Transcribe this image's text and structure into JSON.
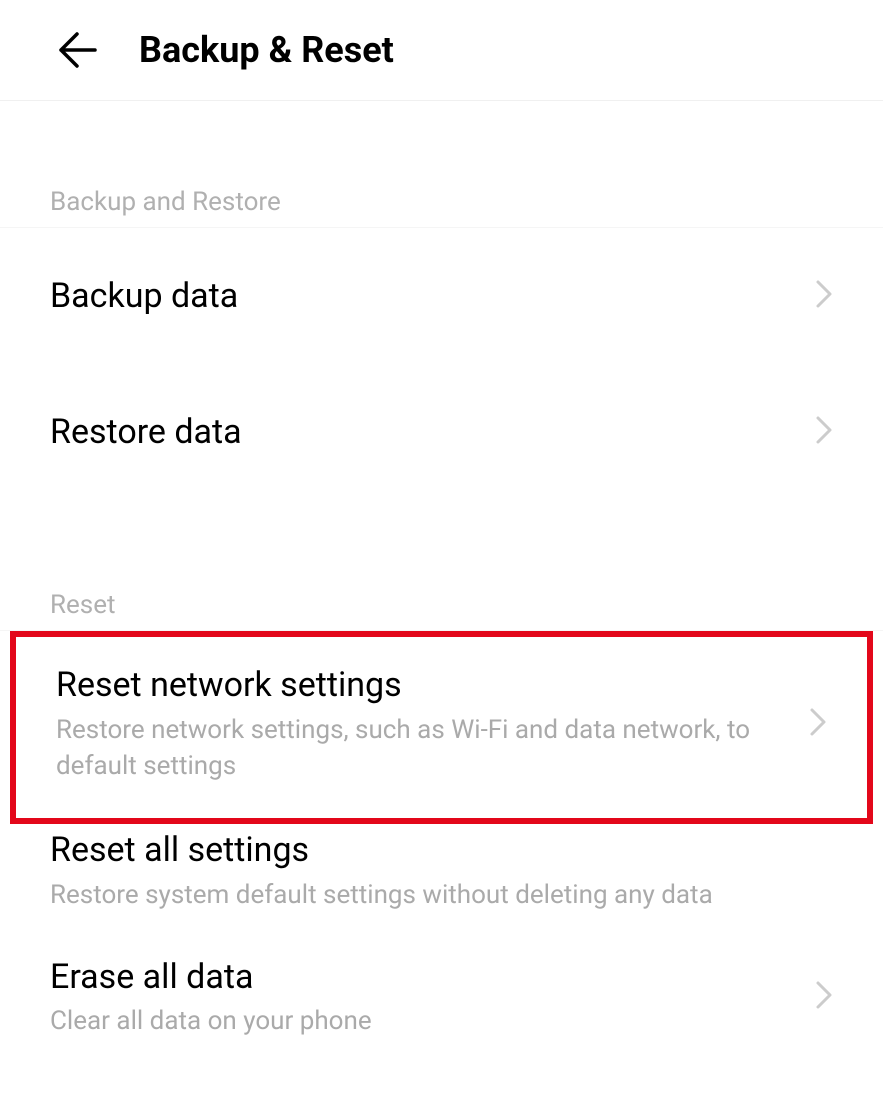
{
  "header": {
    "title": "Backup & Reset"
  },
  "sections": {
    "backup": {
      "header": "Backup and Restore",
      "items": [
        {
          "title": "Backup data"
        },
        {
          "title": "Restore data"
        }
      ]
    },
    "reset": {
      "header": "Reset",
      "items": [
        {
          "title": "Reset network settings",
          "subtitle": "Restore network settings, such as Wi-Fi and data network, to default settings"
        },
        {
          "title": "Reset all settings",
          "subtitle": "Restore system default settings without deleting any data"
        },
        {
          "title": "Erase all data",
          "subtitle": "Clear all data on your phone"
        }
      ]
    }
  }
}
